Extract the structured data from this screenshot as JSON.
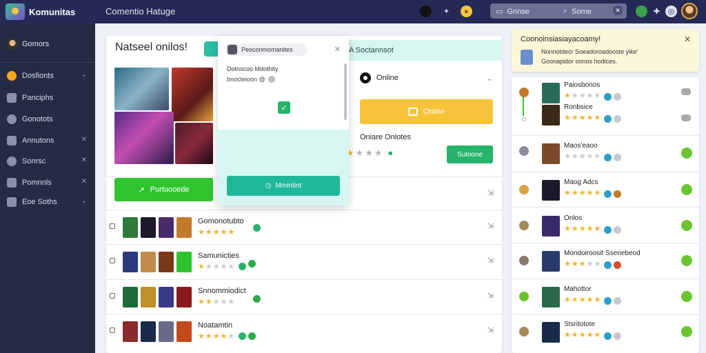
{
  "app": {
    "brand": "Komunitas",
    "title": "Comentio Hatuge"
  },
  "top_search": {
    "left_label": "Gnnse",
    "right_label": "Some"
  },
  "sidebar": {
    "user": "Gomors",
    "items": [
      {
        "label": "Dosfionts",
        "icon": "home-icon"
      },
      {
        "label": "Panciphs",
        "icon": "grid-icon"
      },
      {
        "label": "Gonotots",
        "icon": "people-icon"
      },
      {
        "label": "Annutons",
        "icon": "chart-icon"
      },
      {
        "label": "Sonrsc",
        "icon": "gear-icon"
      },
      {
        "label": "Pomnnls",
        "icon": "list-icon"
      },
      {
        "label": "Eoe Soths",
        "icon": "book-icon"
      }
    ]
  },
  "main": {
    "title": "Natseel onilos!",
    "tab_right": "A Soctannsot",
    "hero_button": "Purtuooede",
    "status": "Online",
    "yellow_button": "Online",
    "notes_title": "Oniare Onlotes",
    "small_button": "Sutoone",
    "rows": [
      {
        "name": "Gomonotubto",
        "stars": 5
      },
      {
        "name": "Samunicties",
        "stars": 1
      },
      {
        "name": "Snnommiodict",
        "stars": 2
      },
      {
        "name": "Noatamtin",
        "stars": 4
      }
    ]
  },
  "modal": {
    "chip": "Peoconmomanites",
    "line1": "Dotnscoo Mdothity",
    "line2": "bnocteioon @",
    "button": "Mmintint"
  },
  "notification": {
    "title": "Coonoinsiasiayacoamy!",
    "line1": "Nonnotdecr Soeadoroadooste yike'",
    "line2": "Goonapidor oonos hodices."
  },
  "rlist": [
    {
      "name": "Paiosbonos",
      "stars": 1
    },
    {
      "name": "Ronbsice",
      "stars": 5
    },
    {
      "name": "Maos'eaoo",
      "stars": 0
    },
    {
      "name": "Maog Adcs",
      "stars": 5
    },
    {
      "name": "Onlos",
      "stars": 5
    },
    {
      "name": "Mondoiroosit Ssenebeod",
      "stars": 3
    },
    {
      "name": "Mahottor",
      "stars": 5
    },
    {
      "name": "Stsritotote",
      "stars": 5
    }
  ],
  "colors": {
    "topbar": "#242a55",
    "sidebar": "#262b45",
    "green": "#2fc42f",
    "yellow": "#f6c338",
    "teal": "#20b89a"
  }
}
